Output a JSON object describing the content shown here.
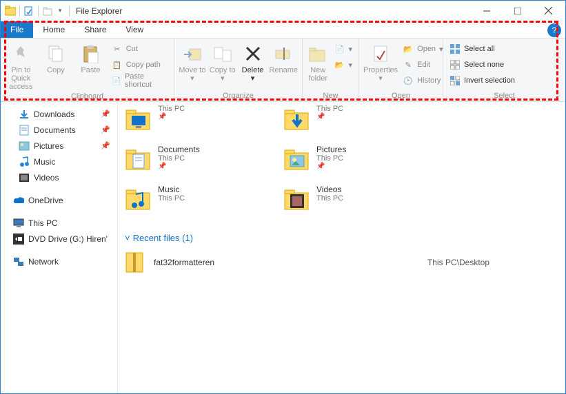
{
  "title": "File Explorer",
  "tabs": {
    "file": "File",
    "home": "Home",
    "share": "Share",
    "view": "View"
  },
  "ribbon": {
    "pin": "Pin to Quick access",
    "copy": "Copy",
    "paste": "Paste",
    "cut": "Cut",
    "copypath": "Copy path",
    "pastesc": "Paste shortcut",
    "moveto": "Move to",
    "copyto": "Copy to",
    "delete": "Delete",
    "rename": "Rename",
    "newfolder": "New folder",
    "properties": "Properties",
    "open": "Open",
    "edit": "Edit",
    "history": "History",
    "selectall": "Select all",
    "selectnone": "Select none",
    "invert": "Invert selection",
    "g_clipboard": "Clipboard",
    "g_organize": "Organize",
    "g_new": "New",
    "g_open": "Open",
    "g_select": "Select"
  },
  "sidebar": {
    "downloads": "Downloads",
    "documents": "Documents",
    "pictures": "Pictures",
    "music": "Music",
    "videos": "Videos",
    "onedrive": "OneDrive",
    "thispc": "This PC",
    "dvd": "DVD Drive (G:) Hiren'",
    "network": "Network"
  },
  "folders": [
    {
      "name": "",
      "sub": "This PC",
      "icon": "desktop"
    },
    {
      "name": "",
      "sub": "This PC",
      "icon": "downloads"
    },
    {
      "name": "Documents",
      "sub": "This PC",
      "icon": "documents"
    },
    {
      "name": "Pictures",
      "sub": "This PC",
      "icon": "pictures"
    },
    {
      "name": "Music",
      "sub": "This PC",
      "icon": "music"
    },
    {
      "name": "Videos",
      "sub": "This PC",
      "icon": "videos"
    }
  ],
  "recent": {
    "title": "Recent files (1)",
    "items": [
      {
        "name": "fat32formatteren",
        "loc": "This PC\\Desktop"
      }
    ]
  }
}
